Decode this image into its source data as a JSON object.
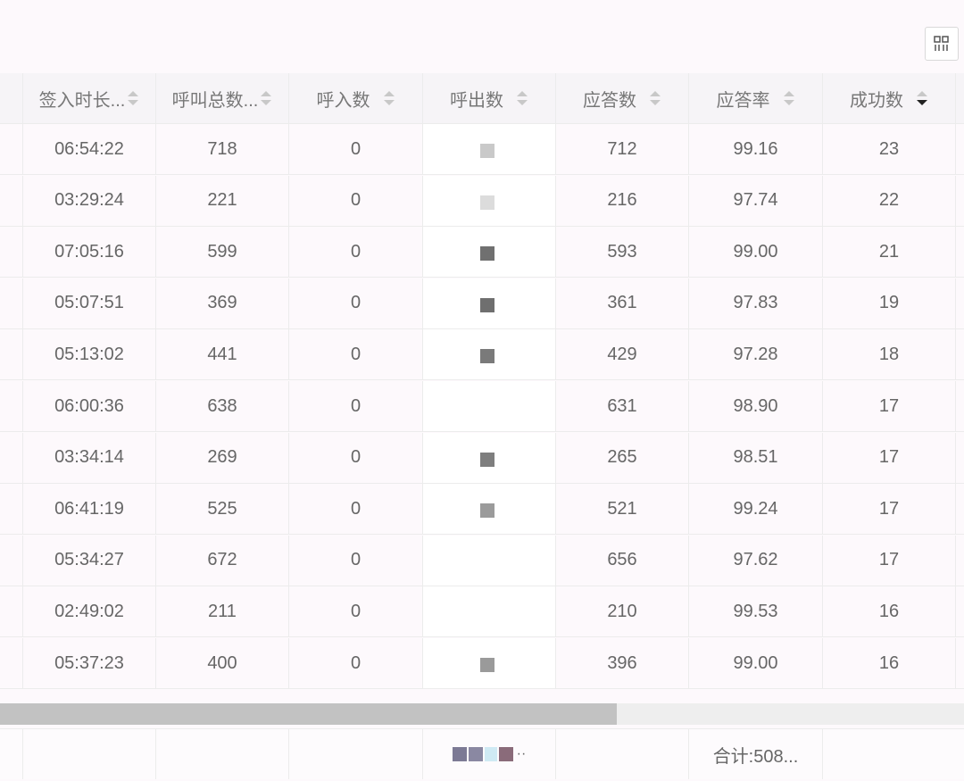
{
  "toolbar": {
    "column_settings_icon": "grid-columns-icon"
  },
  "table": {
    "headers": {
      "checkin_duration": "签入时长...",
      "total_calls": "呼叫总数...",
      "inbound": "呼入数",
      "outbound": "呼出数",
      "answered": "应答数",
      "answer_rate": "应答率",
      "success": "成功数"
    },
    "sorted_column": "success",
    "sort_direction": "descending",
    "rows": [
      {
        "checkin_duration": "06:54:22",
        "total_calls": "718",
        "inbound": "0",
        "answered": "712",
        "answer_rate": "99.16",
        "success": "23"
      },
      {
        "checkin_duration": "03:29:24",
        "total_calls": "221",
        "inbound": "0",
        "answered": "216",
        "answer_rate": "97.74",
        "success": "22"
      },
      {
        "checkin_duration": "07:05:16",
        "total_calls": "599",
        "inbound": "0",
        "answered": "593",
        "answer_rate": "99.00",
        "success": "21"
      },
      {
        "checkin_duration": "05:07:51",
        "total_calls": "369",
        "inbound": "0",
        "answered": "361",
        "answer_rate": "97.83",
        "success": "19"
      },
      {
        "checkin_duration": "05:13:02",
        "total_calls": "441",
        "inbound": "0",
        "answered": "429",
        "answer_rate": "97.28",
        "success": "18"
      },
      {
        "checkin_duration": "06:00:36",
        "total_calls": "638",
        "inbound": "0",
        "answered": "631",
        "answer_rate": "98.90",
        "success": "17"
      },
      {
        "checkin_duration": "03:34:14",
        "total_calls": "269",
        "inbound": "0",
        "answered": "265",
        "answer_rate": "98.51",
        "success": "17"
      },
      {
        "checkin_duration": "06:41:19",
        "total_calls": "525",
        "inbound": "0",
        "answered": "521",
        "answer_rate": "99.24",
        "success": "17"
      },
      {
        "checkin_duration": "05:34:27",
        "total_calls": "672",
        "inbound": "0",
        "answered": "656",
        "answer_rate": "97.62",
        "success": "17"
      },
      {
        "checkin_duration": "02:49:02",
        "total_calls": "211",
        "inbound": "0",
        "answered": "210",
        "answer_rate": "99.53",
        "success": "16"
      },
      {
        "checkin_duration": "05:37:23",
        "total_calls": "400",
        "inbound": "0",
        "answered": "396",
        "answer_rate": "99.00",
        "success": "16"
      }
    ],
    "footer": {
      "total_label": "合计:508...",
      "ellipsis": "··"
    },
    "horizontal_scroll_fraction": 0.64
  },
  "colors": {
    "page_bg": "#fdf9fc",
    "header_bg": "#f6f4f7",
    "border": "#ececec",
    "scroll_thumb": "#c2c2c2",
    "active_sort": "#222222"
  }
}
